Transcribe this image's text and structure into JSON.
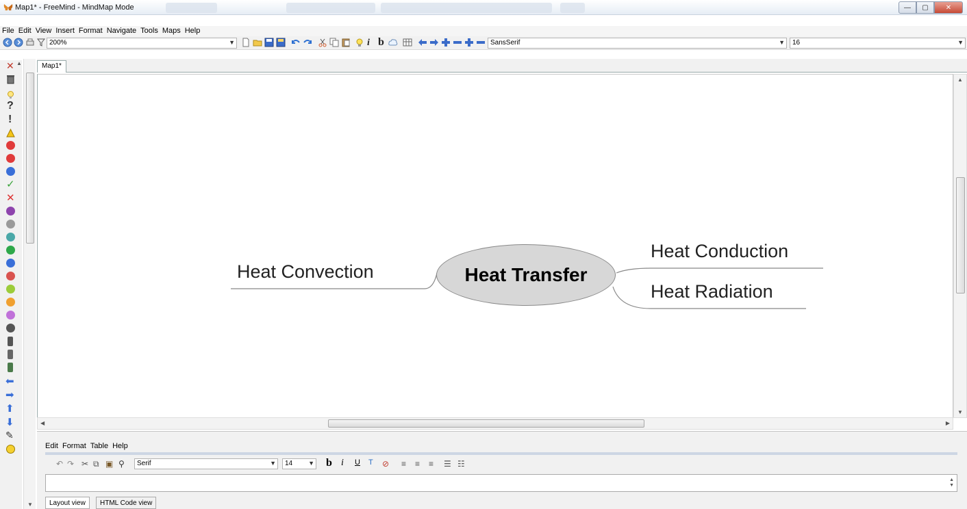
{
  "window": {
    "title": "Map1* - FreeMind - MindMap Mode",
    "controls": [
      "—",
      "▢",
      "✕"
    ]
  },
  "menubar": {
    "items": [
      "File",
      "Edit",
      "View",
      "Insert",
      "Format",
      "Navigate",
      "Tools",
      "Maps",
      "Help"
    ]
  },
  "toolbar": {
    "zoom_value": "200%",
    "font_value": "SansSerif",
    "size_value": "16"
  },
  "tabs": [
    {
      "label": "Map1*"
    }
  ],
  "mindmap": {
    "root": "Heat Transfer",
    "children": [
      "Heat Convection",
      "Heat Conduction",
      "Heat Radiation"
    ]
  },
  "notes_panel": {
    "menu": [
      "Edit",
      "Format",
      "Table",
      "Help"
    ],
    "font_value": "Serif",
    "size_value": "14",
    "view_tabs": [
      "Layout view",
      "HTML Code view"
    ]
  },
  "colors": {
    "root_fill": "#d7d7d7",
    "edge": "#888888",
    "accent": "#2b6fc5"
  },
  "icons": {
    "toolbar": [
      "back-icon",
      "forward-icon",
      "print-icon",
      "filter-icon",
      "new-icon",
      "open-icon",
      "save-icon",
      "save-as-icon",
      "undo-icon",
      "redo-icon",
      "cut-icon",
      "copy-icon",
      "paste-icon",
      "idea-icon",
      "italic-icon",
      "bold-icon",
      "cloud-icon",
      "table-icon",
      "left-arrow-icon",
      "right-arrow-icon",
      "add-icon",
      "minus-icon",
      "add-icon",
      "minus-icon"
    ],
    "left_strip": [
      "remove-icon",
      "trash-icon",
      "idea-icon",
      "question-icon",
      "exclamation-icon",
      "warning-icon",
      "stop-icon",
      "stop-icon",
      "info-icon",
      "check-icon",
      "cross-icon",
      "one-icon",
      "two-icon",
      "three-icon",
      "four-icon",
      "five-icon",
      "six-icon",
      "seven-icon",
      "eight-icon",
      "nine-icon",
      "zero-icon",
      "traffic-light-icon",
      "traffic-light-icon",
      "traffic-light-icon",
      "left-arrow-icon",
      "right-arrow-icon",
      "up-arrow-icon",
      "down-arrow-icon",
      "pencil-icon",
      "smiley-icon"
    ]
  }
}
